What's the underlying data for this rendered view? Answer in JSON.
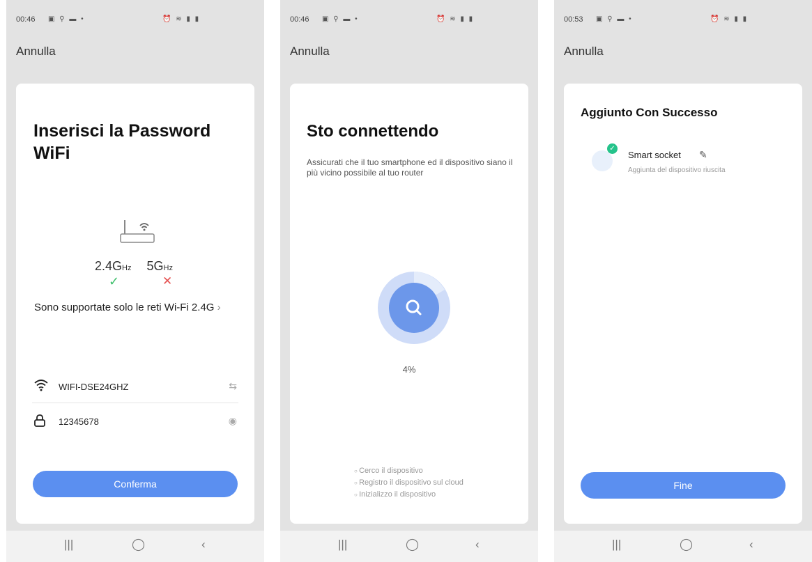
{
  "screens": [
    {
      "status": {
        "time": "00:46"
      },
      "cancel_label": "Annulla",
      "title": "Inserisci la Password WiFi",
      "band_24": "2.4G",
      "band_5": "5G",
      "hz_unit": "Hz",
      "support_text": "Sono supportate solo le reti Wi-Fi 2.4G",
      "ssid_value": "WIFI-DSE24GHZ",
      "password_value": "12345678",
      "confirm_label": "Conferma"
    },
    {
      "status": {
        "time": "00:46"
      },
      "cancel_label": "Annulla",
      "title": "Sto connettendo",
      "description": "Assicurati che il tuo smartphone ed il dispositivo siano il più vicino possibile al tuo router",
      "progress_percent": 4,
      "progress_text": "4%",
      "steps": [
        "Cerco il dispositivo",
        "Registro il dispositivo sul cloud",
        "Inizializzo il dispositivo"
      ]
    },
    {
      "status": {
        "time": "00:53"
      },
      "cancel_label": "Annulla",
      "title": "Aggiunto Con Successo",
      "device_name": "Smart socket",
      "device_status": "Aggiunta del dispositivo riuscita",
      "done_label": "Fine"
    }
  ],
  "colors": {
    "accent": "#5b8ff0",
    "success": "#3cbf6a",
    "error": "#e55050",
    "badge": "#25c38b"
  },
  "icons": [
    "wifi-icon",
    "lock-icon",
    "swap-icon",
    "eye-icon",
    "search-icon",
    "edit-icon",
    "check-icon",
    "cross-icon",
    "router-icon"
  ]
}
